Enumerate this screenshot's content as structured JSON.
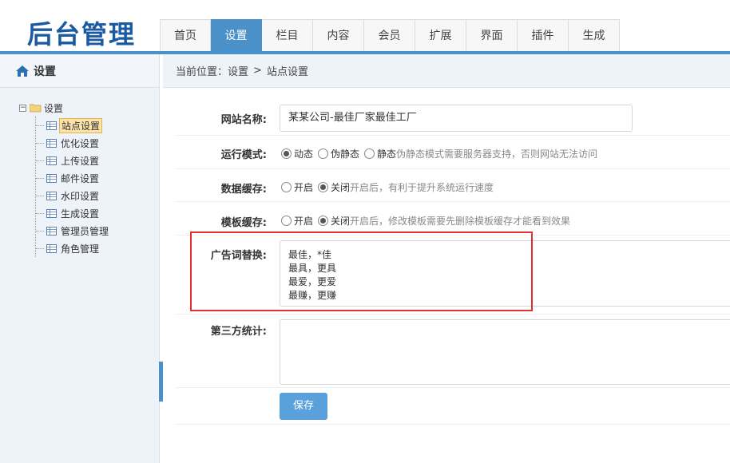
{
  "app": {
    "logo": "后台管理"
  },
  "nav": {
    "tabs": [
      "首页",
      "设置",
      "栏目",
      "内容",
      "会员",
      "扩展",
      "界面",
      "插件",
      "生成"
    ],
    "active_index": 1
  },
  "sidebar": {
    "title": "设置",
    "tree_root": "设置",
    "items": [
      "站点设置",
      "优化设置",
      "上传设置",
      "邮件设置",
      "水印设置",
      "生成设置",
      "管理员管理",
      "角色管理"
    ],
    "active_index": 0
  },
  "breadcrumb": {
    "prefix": "当前位置：",
    "level1": "设置",
    "separator": ">",
    "level2": "站点设置"
  },
  "form": {
    "site_name": {
      "label": "网站名称:",
      "value": "某某公司-最佳厂家最佳工厂"
    },
    "run_mode": {
      "label": "运行模式:",
      "options": [
        "动态",
        "伪静态",
        "静态"
      ],
      "selected": 0,
      "hint": "伪静态模式需要服务器支持，否则网站无法访问"
    },
    "data_cache": {
      "label": "数据缓存:",
      "options": [
        "开启",
        "关闭"
      ],
      "selected": 1,
      "hint": "开启后，有利于提升系统运行速度"
    },
    "template_cache": {
      "label": "模板缓存:",
      "options": [
        "开启",
        "关闭"
      ],
      "selected": 1,
      "hint": "开启后，修改模板需要先删除模板缓存才能看到效果"
    },
    "ad_replace": {
      "label": "广告词替换:",
      "lines": [
        "最佳，*佳",
        "最具，更具",
        "最爱，更爱",
        "最赚，更赚"
      ]
    },
    "third_party": {
      "label": "第三方统计:",
      "value": ""
    },
    "save_label": "保存"
  },
  "colors": {
    "accent": "#4a90c9",
    "highlight": "#e03030",
    "button": "#5aa1db"
  }
}
